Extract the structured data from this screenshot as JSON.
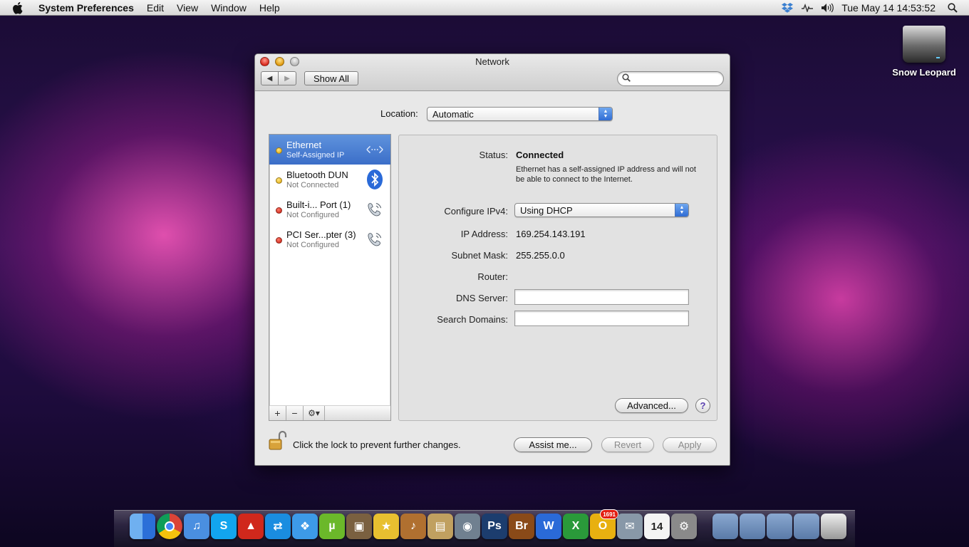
{
  "menubar": {
    "app_name": "System Preferences",
    "items": [
      "Edit",
      "View",
      "Window",
      "Help"
    ],
    "clock": "Tue May 14  14:53:52",
    "status_icons": [
      "dropbox-icon",
      "activity-icon",
      "volume-icon"
    ]
  },
  "desktop": {
    "drive_label": "Snow Leopard"
  },
  "window": {
    "title": "Network",
    "show_all": "Show All",
    "search_placeholder": "",
    "location_label": "Location:",
    "location_value": "Automatic",
    "services": [
      {
        "name": "Ethernet",
        "status": "Self-Assigned IP",
        "dot": "yellow",
        "icon": "ethernet-icon",
        "selected": true
      },
      {
        "name": "Bluetooth DUN",
        "status": "Not Connected",
        "dot": "yellow",
        "icon": "bluetooth-icon",
        "selected": false
      },
      {
        "name": "Built-i... Port (1)",
        "status": "Not Configured",
        "dot": "red",
        "icon": "modem-phone-icon",
        "selected": false
      },
      {
        "name": "PCI Ser...pter (3)",
        "status": "Not Configured",
        "dot": "red",
        "icon": "modem-phone-icon",
        "selected": false
      }
    ],
    "list_buttons": {
      "add": "+",
      "remove": "−",
      "gear": "⚙▾"
    },
    "detail": {
      "status_label": "Status:",
      "status_value": "Connected",
      "status_desc": "Ethernet has a self-assigned IP address and will not be able to connect to the Internet.",
      "configure_label": "Configure IPv4:",
      "configure_value": "Using DHCP",
      "ip_label": "IP Address:",
      "ip_value": "169.254.143.191",
      "subnet_label": "Subnet Mask:",
      "subnet_value": "255.255.0.0",
      "router_label": "Router:",
      "router_value": "",
      "dns_label": "DNS Server:",
      "dns_value": "",
      "search_domains_label": "Search Domains:",
      "search_domains_value": "",
      "advanced": "Advanced...",
      "help": "?"
    },
    "lock_text": "Click the lock to prevent further changes.",
    "assist": "Assist me...",
    "revert": "Revert",
    "apply": "Apply"
  },
  "dock": {
    "apps": [
      {
        "name": "finder-icon",
        "label": "",
        "color": "#3b7be0"
      },
      {
        "name": "chrome-icon",
        "label": "",
        "color": "#e8e8e8"
      },
      {
        "name": "itunes-icon",
        "label": "♫",
        "color": "#4a8fe0"
      },
      {
        "name": "skype-icon",
        "label": "S",
        "color": "#12a5ee"
      },
      {
        "name": "flame-app-icon",
        "label": "▲",
        "color": "#d0281c"
      },
      {
        "name": "teamviewer-icon",
        "label": "⇄",
        "color": "#1a8de0"
      },
      {
        "name": "dropbox-dock-icon",
        "label": "❖",
        "color": "#3d9ae8"
      },
      {
        "name": "utorrent-icon",
        "label": "µ",
        "color": "#6bb82a"
      },
      {
        "name": "iphoto-icon",
        "label": "▣",
        "color": "#7a6040"
      },
      {
        "name": "imovie-icon",
        "label": "★",
        "color": "#e8c030"
      },
      {
        "name": "garageband-icon",
        "label": "♪",
        "color": "#b07030"
      },
      {
        "name": "preview-icon",
        "label": "▤",
        "color": "#c0a060"
      },
      {
        "name": "disk-utility-icon",
        "label": "◉",
        "color": "#708090"
      },
      {
        "name": "photoshop-icon",
        "label": "Ps",
        "color": "#1c3d6e"
      },
      {
        "name": "bridge-icon",
        "label": "Br",
        "color": "#8a4a18"
      },
      {
        "name": "word-icon",
        "label": "W",
        "color": "#2a6ad8"
      },
      {
        "name": "excel-icon",
        "label": "X",
        "color": "#2a9a3a"
      },
      {
        "name": "outlook-icon",
        "label": "O",
        "color": "#e8b010",
        "badge": "1691"
      },
      {
        "name": "mail-icon",
        "label": "✉",
        "color": "#8898a8"
      },
      {
        "name": "ical-icon",
        "label": "14",
        "color": "#f4f4f4"
      },
      {
        "name": "system-preferences-icon",
        "label": "⚙",
        "color": "#8a8a8a"
      }
    ],
    "stacks": [
      {
        "name": "applications-folder-icon",
        "color": "#8aa8d0"
      },
      {
        "name": "pictures-folder-icon",
        "color": "#8aa8d0"
      },
      {
        "name": "documents-folder-icon",
        "color": "#8aa8d0"
      },
      {
        "name": "downloads-folder-icon",
        "color": "#8aa8d0"
      },
      {
        "name": "trash-icon",
        "color": "#c8c8c8"
      }
    ]
  }
}
